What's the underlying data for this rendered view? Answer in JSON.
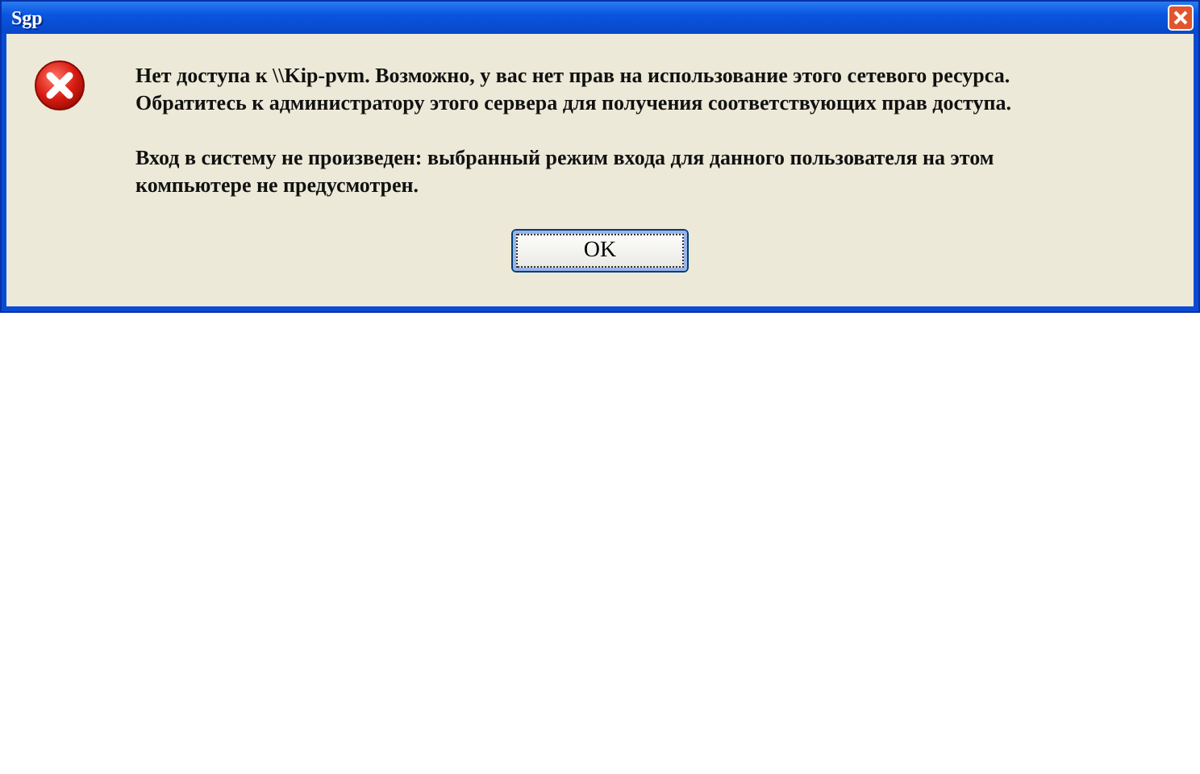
{
  "window": {
    "title": "Sgp"
  },
  "message": {
    "paragraphs": [
      "Нет доступа к \\\\Kip-pvm. Возможно, у вас нет прав на использование этого сетевого ресурса.\nОбратитесь к администратору этого сервера для получения соответствующих прав доступа.",
      "Вход в систему не произведен: выбранный режим входа для данного пользователя на этом\nкомпьютере не предусмотрен."
    ]
  },
  "buttons": [
    {
      "label": "OK",
      "focused": true
    }
  ]
}
